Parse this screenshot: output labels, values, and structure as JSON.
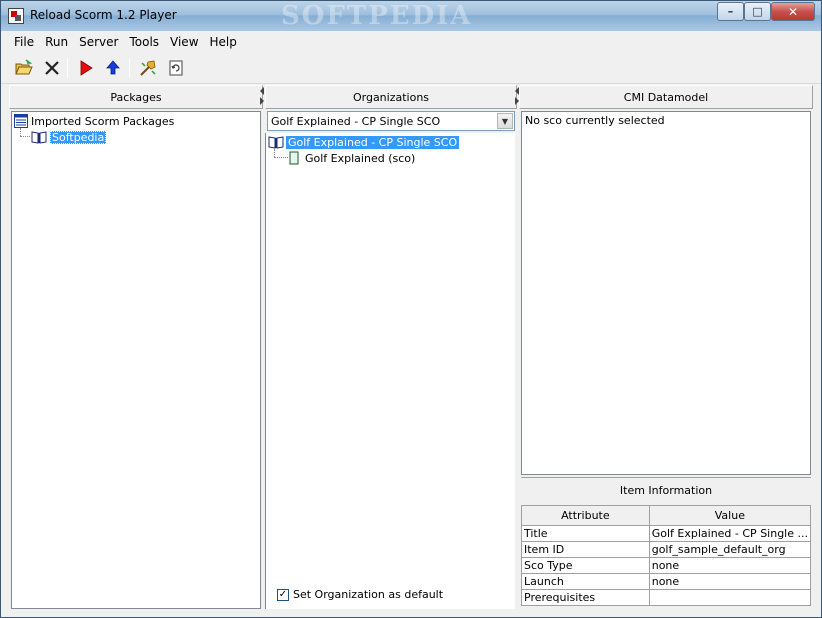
{
  "window": {
    "title": "Reload Scorm 1.2 Player",
    "watermark": "SOFTPEDIA"
  },
  "titlebar_buttons": {
    "minimize": "–",
    "maximize": "□",
    "close": "✕"
  },
  "menu": [
    "File",
    "Run",
    "Server",
    "Tools",
    "View",
    "Help"
  ],
  "toolbar_icons": [
    "open-folder-icon",
    "delete-icon",
    "play-icon",
    "upload-icon",
    "settings-tool-icon",
    "refresh-document-icon"
  ],
  "packages": {
    "header": "Packages",
    "root_label": "Imported Scorm Packages",
    "child_label": "Softpedia"
  },
  "organizations": {
    "header": "Organizations",
    "selected_org": "Golf Explained - CP Single SCO",
    "tree_root": "Golf Explained - CP Single SCO",
    "tree_child": "Golf Explained (sco)",
    "default_checkbox_label": "Set Organization as default",
    "default_checked": true
  },
  "cmi": {
    "header": "CMI Datamodel",
    "empty_text": "No sco currently selected"
  },
  "item_info": {
    "header": "Item Information",
    "columns": [
      "Attribute",
      "Value"
    ],
    "rows": [
      {
        "attr": "Title",
        "value": "Golf Explained - CP Single ..."
      },
      {
        "attr": "Item ID",
        "value": "golf_sample_default_org"
      },
      {
        "attr": "Sco Type",
        "value": "none"
      },
      {
        "attr": "Launch",
        "value": "none"
      },
      {
        "attr": "Prerequisites",
        "value": ""
      }
    ]
  },
  "colors": {
    "selection": "#3399ff",
    "titlebar": "#9fbfdd",
    "panel": "#f0f0f0"
  }
}
